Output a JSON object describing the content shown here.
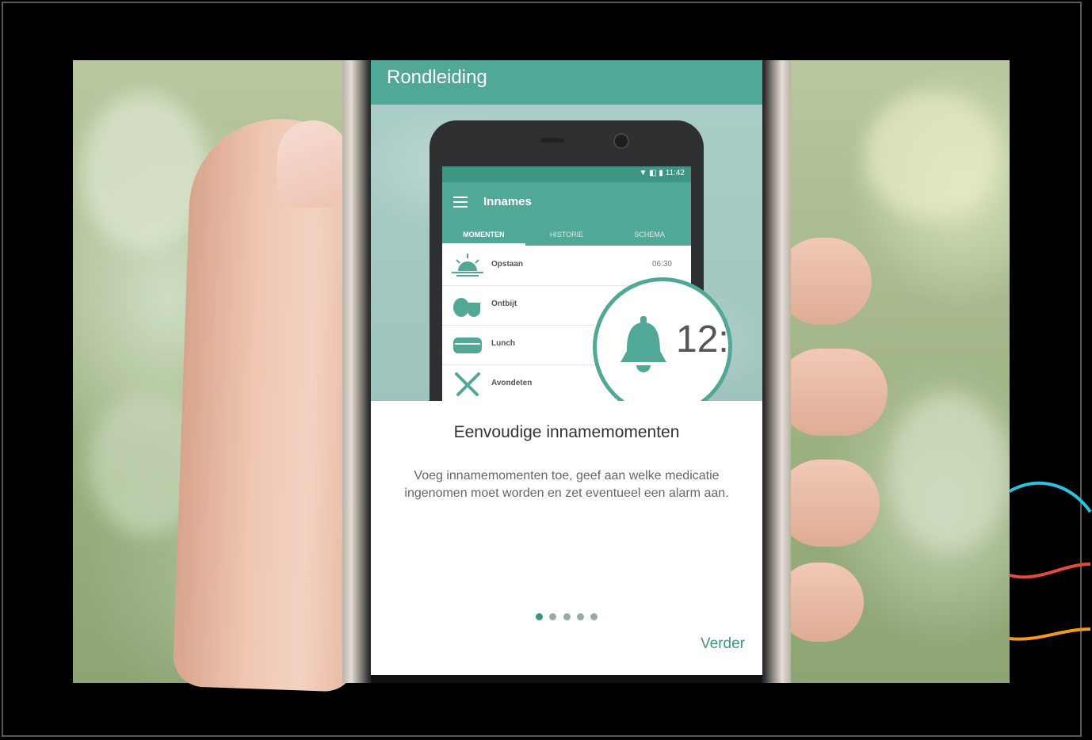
{
  "appbar": {
    "title": "Rondleiding"
  },
  "illustration": {
    "status_time": "▼ ◧ ▮ 11:42",
    "toolbar_title": "Innames",
    "tabs": [
      "MOMENTEN",
      "HISTORIE",
      "SCHEMA"
    ],
    "rows": [
      {
        "label": "Opstaan",
        "time": "06:30",
        "icon": "sunrise-icon"
      },
      {
        "label": "Ontbijt",
        "time": "",
        "icon": "breakfast-icon"
      },
      {
        "label": "Lunch",
        "time": "",
        "icon": "lunch-icon"
      },
      {
        "label": "Avondeten",
        "time": "",
        "icon": "dinner-icon"
      }
    ],
    "magnifier_time": "12:"
  },
  "card": {
    "title": "Eenvoudige innamemomenten",
    "body": "Voeg innamemomenten toe, geef aan welke medicatie ingenomen moet worden en zet eventueel een alarm aan.",
    "page_indicator": {
      "current": 1,
      "total": 5
    },
    "next_label": "Verder"
  },
  "colors": {
    "accent": "#52a897",
    "accent_dark": "#3f9584",
    "deco_lines": [
      "#29c3e0",
      "#e84a3a",
      "#f39a1e"
    ]
  }
}
